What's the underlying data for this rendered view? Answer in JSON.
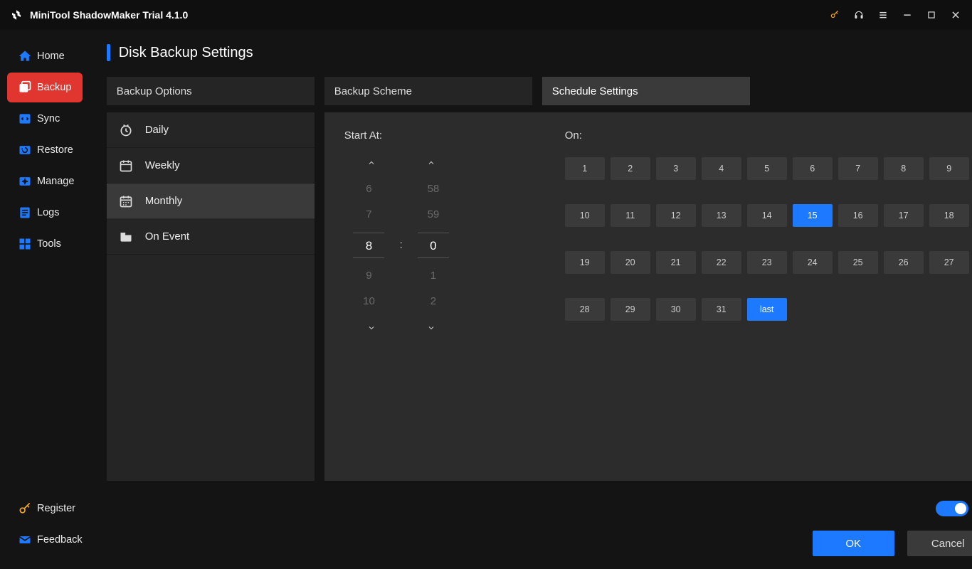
{
  "app": {
    "title": "MiniTool ShadowMaker Trial 4.1.0"
  },
  "sidebar": {
    "items": [
      {
        "label": "Home"
      },
      {
        "label": "Backup"
      },
      {
        "label": "Sync"
      },
      {
        "label": "Restore"
      },
      {
        "label": "Manage"
      },
      {
        "label": "Logs"
      },
      {
        "label": "Tools"
      }
    ],
    "bottom": [
      {
        "label": "Register"
      },
      {
        "label": "Feedback"
      }
    ]
  },
  "page": {
    "title": "Disk Backup Settings"
  },
  "tabs": {
    "options": "Backup Options",
    "scheme": "Backup Scheme",
    "schedule": "Schedule Settings"
  },
  "periods": {
    "daily": "Daily",
    "weekly": "Weekly",
    "monthly": "Monthly",
    "onevent": "On Event"
  },
  "schedule": {
    "start_label": "Start At:",
    "on_label": "On:",
    "hour_wheel": [
      "6",
      "7",
      "8",
      "9",
      "10"
    ],
    "minute_wheel": [
      "58",
      "59",
      "0",
      "1",
      "2"
    ],
    "selected_hour": "8",
    "selected_minute": "0",
    "days_row1": [
      "1",
      "2",
      "3",
      "4",
      "5",
      "6",
      "7",
      "8",
      "9"
    ],
    "days_row2": [
      "10",
      "11",
      "12",
      "13",
      "14",
      "15",
      "16",
      "17",
      "18"
    ],
    "days_row3": [
      "19",
      "20",
      "21",
      "22",
      "23",
      "24",
      "25",
      "26",
      "27"
    ],
    "days_row4": [
      "28",
      "29",
      "30",
      "31",
      "last"
    ],
    "selected_days": [
      "15",
      "last"
    ]
  },
  "footer": {
    "toggle_state": "On",
    "ok": "OK",
    "cancel": "Cancel"
  }
}
